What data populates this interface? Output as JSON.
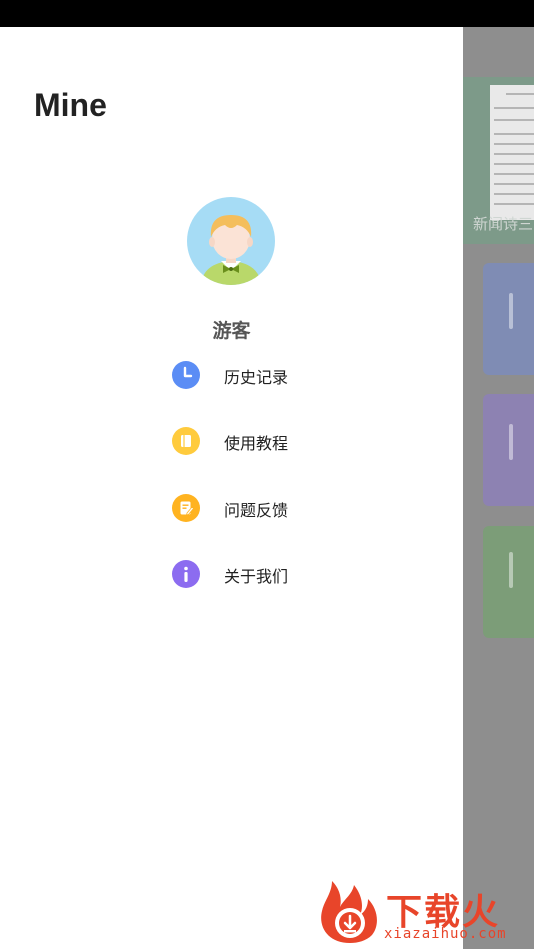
{
  "drawer": {
    "title": "Mine",
    "username": "游客",
    "menu": [
      {
        "label": "历史记录",
        "icon": "clock-icon",
        "color": "#5b8df5"
      },
      {
        "label": "使用教程",
        "icon": "book-icon",
        "color": "#ffcb3d"
      },
      {
        "label": "问题反馈",
        "icon": "edit-note-icon",
        "color": "#ffb320"
      },
      {
        "label": "关于我们",
        "icon": "info-icon",
        "color": "#8c6cf0"
      }
    ]
  },
  "background": {
    "banner_text": "新闻诗三"
  },
  "watermark": {
    "brand": "下载火",
    "url": "xiazaihuo.com",
    "color": "#e8452a"
  }
}
